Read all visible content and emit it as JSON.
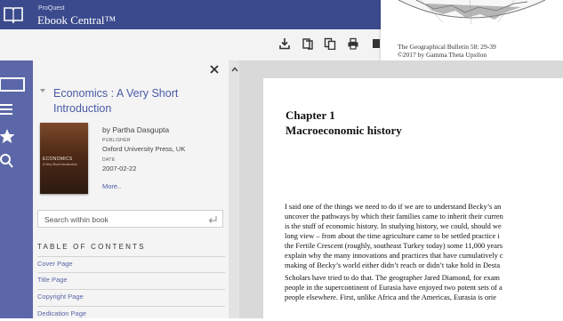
{
  "header": {
    "brand_small": "ProQuest",
    "brand_main": "Ebook Central™"
  },
  "toolbar": {
    "icons": [
      "download-icon",
      "copy-pages-icon",
      "copy-icon",
      "print-icon",
      "cite-icon"
    ]
  },
  "map_popup": {
    "caption_line1": "The Geographical Bulletin 58: 29-39",
    "caption_line2": "©2017 by Gamma Theta Upsilon"
  },
  "leftnav": {
    "icons": [
      "book-icon",
      "contents-icon",
      "bookmark-icon",
      "search-icon"
    ]
  },
  "sidebar": {
    "book_title": "Economics : A Very Short Introduction",
    "cover_title": "ECONOMICS",
    "cover_sub": "A Very Short Introduction",
    "author": "by Partha Dasgupta",
    "publisher_label": "PUBLISHER",
    "publisher": "Oxford University Press, UK",
    "date_label": "DATE",
    "date": "2007-02-22",
    "more": "More..",
    "search_placeholder": "Search within book",
    "toc_heading": "TABLE OF CONTENTS",
    "toc": [
      "Cover Page",
      "Title Page",
      "Copyright Page",
      "Dedication Page"
    ]
  },
  "page": {
    "chapter_number": "Chapter 1",
    "chapter_title": "Macroeconomic history",
    "para1": [
      "I said one of the things we need to do if we are to understand Becky’s an",
      "uncover the pathways by which their families came to inherit their curren",
      "is the stuff of economic history. In studying history, we could, should we",
      "long view – from about the time agriculture came to be settled practice i",
      "the Fertile Crescent (roughly, southeast Turkey today) some 11,000 years",
      "explain why the many innovations and practices that have cumulatively c",
      "making of Becky’s world either didn’t reach or didn’t take hold in Desta"
    ],
    "para2": [
      "Scholars have tried to do that. The geographer Jared Diamond, for exam",
      "people in the supercontinent of Eurasia have enjoyed two potent sets of a",
      "people elsewhere. First, unlike Africa and the Americas, Eurasia is orie"
    ]
  }
}
